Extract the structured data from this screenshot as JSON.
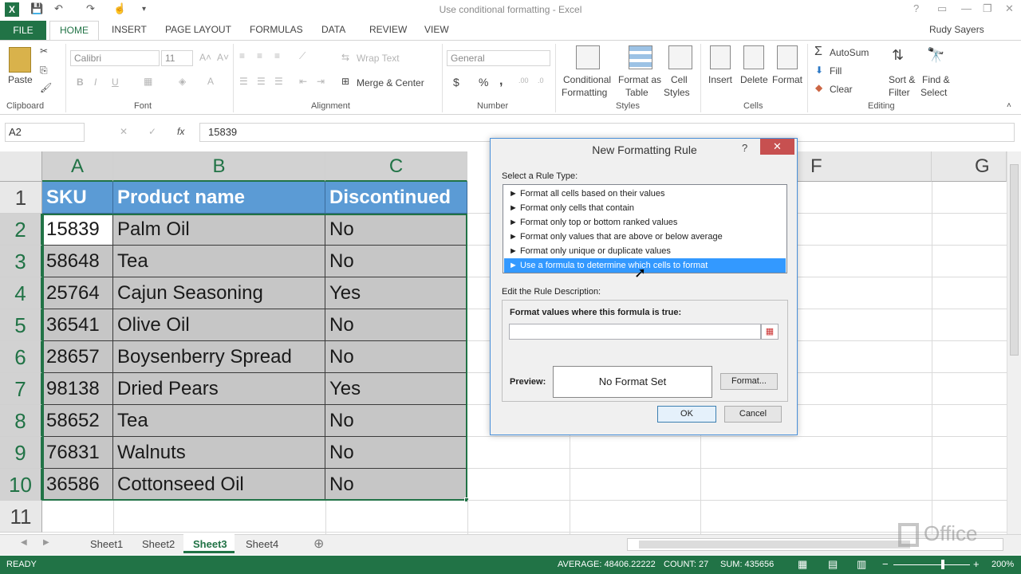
{
  "window": {
    "title": "Use conditional formatting - Excel",
    "user": "Rudy Sayers"
  },
  "tabs": {
    "file": "FILE",
    "home": "HOME",
    "insert": "INSERT",
    "page_layout": "PAGE LAYOUT",
    "formulas": "FORMULAS",
    "data": "DATA",
    "review": "REVIEW",
    "view": "VIEW"
  },
  "ribbon": {
    "clipboard": {
      "paste": "Paste",
      "label": "Clipboard"
    },
    "font": {
      "name": "Calibri",
      "size": "11",
      "label": "Font"
    },
    "alignment": {
      "wrap": "Wrap Text",
      "merge": "Merge & Center",
      "label": "Alignment"
    },
    "number": {
      "format": "General",
      "currency": "$",
      "percent": "%",
      "comma": ",",
      "label": "Number"
    },
    "styles": {
      "conditional": "Conditional",
      "conditional2": "Formatting",
      "format_as": "Format as",
      "table": "Table",
      "cell": "Cell",
      "styles_btn": "Styles",
      "label": "Styles"
    },
    "cells": {
      "insert": "Insert",
      "delete": "Delete",
      "format": "Format",
      "label": "Cells"
    },
    "editing": {
      "autosum": "AutoSum",
      "fill": "Fill",
      "clear": "Clear",
      "sort": "Sort &",
      "filter": "Filter",
      "find": "Find &",
      "select": "Select",
      "label": "Editing"
    }
  },
  "formula_bar": {
    "name_box": "A2",
    "fx": "fx",
    "value": "15839"
  },
  "columns": [
    "A",
    "B",
    "C",
    "F",
    "G"
  ],
  "rows": [
    "1",
    "2",
    "3",
    "4",
    "5",
    "6",
    "7",
    "8",
    "9",
    "10",
    "11"
  ],
  "table": {
    "headers": [
      "SKU",
      "Product name",
      "Discontinued"
    ],
    "data": [
      [
        "15839",
        "Palm Oil",
        "No"
      ],
      [
        "58648",
        "Tea",
        "No"
      ],
      [
        "25764",
        "Cajun Seasoning",
        "Yes"
      ],
      [
        "36541",
        "Olive Oil",
        "No"
      ],
      [
        "28657",
        "Boysenberry Spread",
        "No"
      ],
      [
        "98138",
        "Dried Pears",
        "Yes"
      ],
      [
        "58652",
        "Tea",
        "No"
      ],
      [
        "76831",
        "Walnuts",
        "No"
      ],
      [
        "36586",
        "Cottonseed Oil",
        "No"
      ]
    ]
  },
  "dialog": {
    "title": "New Formatting Rule",
    "help": "?",
    "close": "✕",
    "select_label": "Select a Rule Type:",
    "rule_types": [
      "► Format all cells based on their values",
      "► Format only cells that contain",
      "► Format only top or bottom ranked values",
      "► Format only values that are above or below average",
      "► Format only unique or duplicate values",
      "► Use a formula to determine which cells to format"
    ],
    "edit_label": "Edit the Rule Description:",
    "formula_label": "Format values where this formula is true:",
    "formula_value": "",
    "preview_label": "Preview:",
    "preview_text": "No Format Set",
    "format_button": "Format...",
    "ok": "OK",
    "cancel": "Cancel"
  },
  "sheets": [
    "Sheet1",
    "Sheet2",
    "Sheet3",
    "Sheet4"
  ],
  "active_sheet": "Sheet3",
  "status": {
    "ready": "READY",
    "average": "AVERAGE: 48406.22222",
    "count": "COUNT: 27",
    "sum": "SUM: 435656",
    "zoom": "200%"
  },
  "watermark": "Office",
  "colors": {
    "excel_green": "#217346",
    "header_blue": "#5b9bd5",
    "selection_blue": "#3399ff"
  }
}
